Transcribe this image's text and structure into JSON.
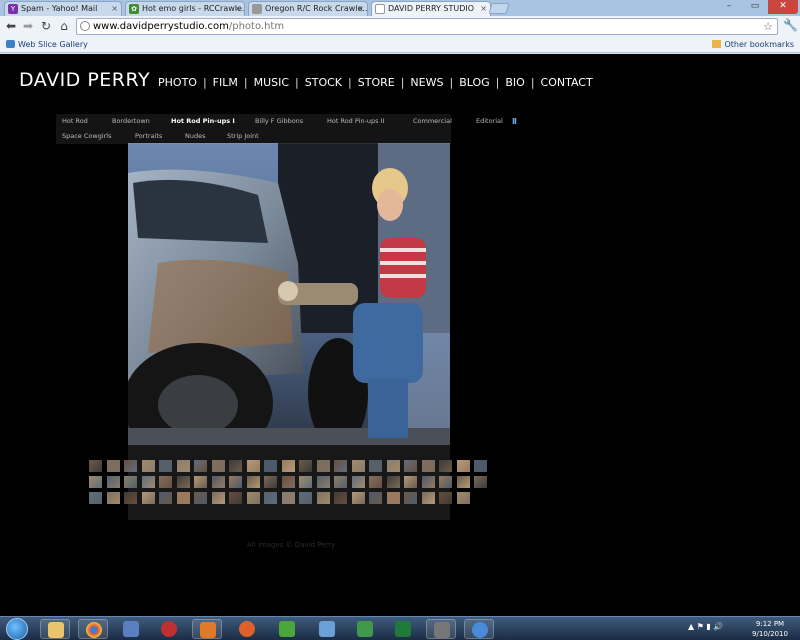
{
  "browser": {
    "tabs": [
      {
        "label": "Spam - Yahoo! Mail",
        "active": false
      },
      {
        "label": "Hot emo girls - RCCrawle...",
        "active": false
      },
      {
        "label": "Oregon R/C Rock Crawle...",
        "active": false
      },
      {
        "label": "DAVID PERRY STUDIO",
        "active": true
      }
    ],
    "url_host": "www.davidperrystudio.com",
    "url_path": "/photo.htm",
    "bookmarks_left": "Web Slice Gallery",
    "bookmarks_right": "Other bookmarks",
    "icons": {
      "back": "back-arrow-icon",
      "forward": "forward-arrow-icon",
      "reload": "reload-icon",
      "home": "home-icon",
      "star": "star-icon",
      "wrench": "wrench-icon"
    }
  },
  "site": {
    "logo": "DAVID PERRY",
    "nav": [
      "PHOTO",
      "FILM",
      "MUSIC",
      "STOCK",
      "STORE",
      "NEWS",
      "BLOG",
      "BIO",
      "CONTACT"
    ],
    "gallery_row1": [
      "Hot Rod",
      "Bordertown",
      "Hot Rod Pin-ups I",
      "Billy F Gibbons",
      "Hot Rod Pin-ups II",
      "Commercial",
      "Editorial"
    ],
    "gallery_row2": [
      "Space Cowgirls",
      "Portraits",
      "Nudes",
      "Strip Joint"
    ],
    "active_gallery": "Hot Rod Pin-ups I",
    "pause_symbol": "II",
    "copyright": "All images © David Perry",
    "accent_color": "#6aa3e0"
  },
  "taskbar": {
    "time": "9:12 PM",
    "date": "9/10/2010"
  }
}
